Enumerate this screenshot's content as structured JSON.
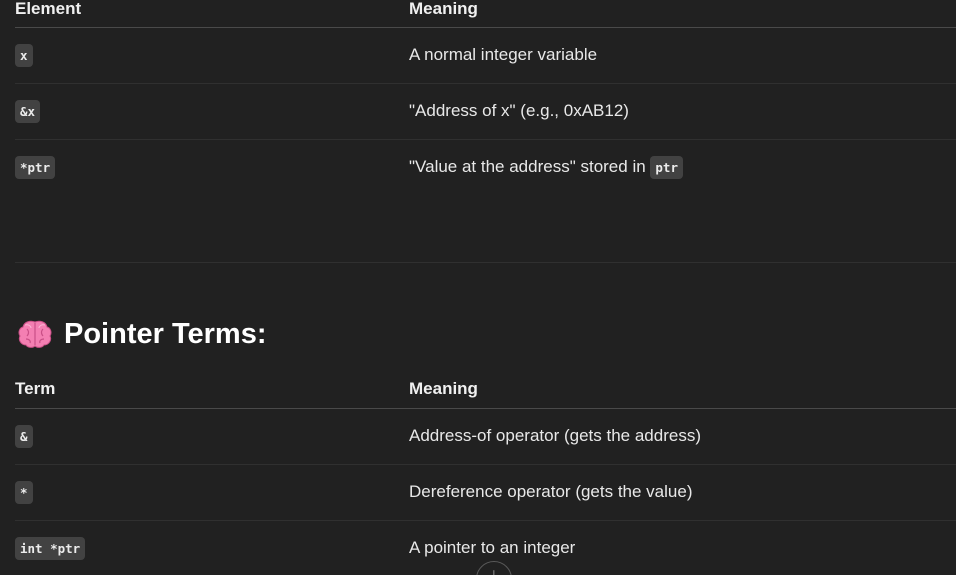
{
  "table1": {
    "headers": [
      "Element",
      "Meaning"
    ],
    "rows": [
      {
        "code": "x",
        "meaning": "A normal integer variable"
      },
      {
        "code": "&x",
        "meaning": "\"Address of x\" (e.g., 0xAB12)"
      },
      {
        "code": "*ptr",
        "meaning_prefix": "\"Value at the address\" stored in",
        "meaning_code": "ptr"
      }
    ]
  },
  "section": {
    "emoji": "brain",
    "title": "Pointer Terms:"
  },
  "table2": {
    "headers": [
      "Term",
      "Meaning"
    ],
    "rows": [
      {
        "code": "&",
        "meaning": "Address-of operator (gets the address)"
      },
      {
        "code": "*",
        "meaning": "Dereference operator (gets the value)"
      },
      {
        "code": "int *ptr",
        "meaning": "A pointer to an integer"
      }
    ]
  },
  "scroll_button": {
    "icon": "arrow-down-icon",
    "glyph": "↓"
  }
}
